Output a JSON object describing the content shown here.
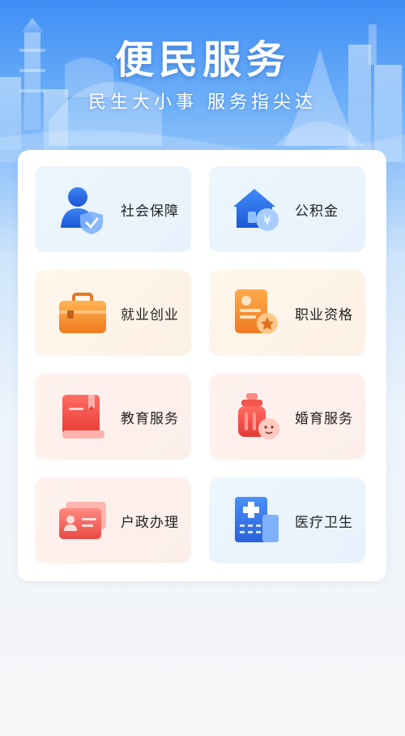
{
  "header": {
    "title": "便民服务",
    "subtitle": "民生大小事  服务指尖达"
  },
  "services": [
    {
      "label": "社会保障",
      "icon": "social-security-icon"
    },
    {
      "label": "公积金",
      "icon": "housing-fund-icon"
    },
    {
      "label": "就业创业",
      "icon": "briefcase-icon"
    },
    {
      "label": "职业资格",
      "icon": "certificate-icon"
    },
    {
      "label": "教育服务",
      "icon": "book-icon"
    },
    {
      "label": "婚育服务",
      "icon": "baby-bottle-icon"
    },
    {
      "label": "户政办理",
      "icon": "id-card-icon"
    },
    {
      "label": "医疗卫生",
      "icon": "hospital-icon"
    }
  ],
  "colors": {
    "accent_blue": "#2f6fe6",
    "accent_orange": "#f08a2c",
    "accent_red": "#ea4b44"
  },
  "icons": {
    "housing_fund_symbol": "¥"
  }
}
